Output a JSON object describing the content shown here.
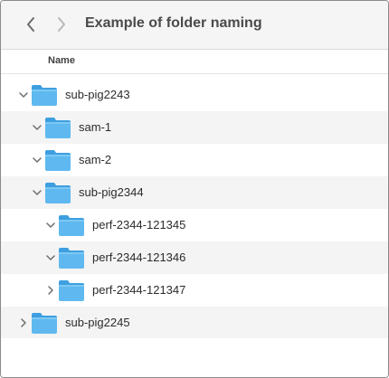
{
  "window": {
    "title": "Example of folder naming"
  },
  "toolbar": {
    "back_icon": "chevron-left-icon",
    "forward_icon": "chevron-right-icon"
  },
  "columns": {
    "name": "Name"
  },
  "colors": {
    "folder_body": "#5fb9f0",
    "folder_tab": "#3e9fe0",
    "row_alt": "#f4f4f4"
  },
  "tree": [
    {
      "label": "sub-pig2243",
      "depth": 0,
      "expanded": true
    },
    {
      "label": "sam-1",
      "depth": 1,
      "expanded": true
    },
    {
      "label": "sam-2",
      "depth": 1,
      "expanded": true
    },
    {
      "label": "sub-pig2344",
      "depth": 1,
      "expanded": true
    },
    {
      "label": "perf-2344-121345",
      "depth": 2,
      "expanded": true
    },
    {
      "label": "perf-2344-121346",
      "depth": 2,
      "expanded": true
    },
    {
      "label": "perf-2344-121347",
      "depth": 2,
      "expanded": false
    },
    {
      "label": "sub-pig2245",
      "depth": 0,
      "expanded": false
    }
  ]
}
